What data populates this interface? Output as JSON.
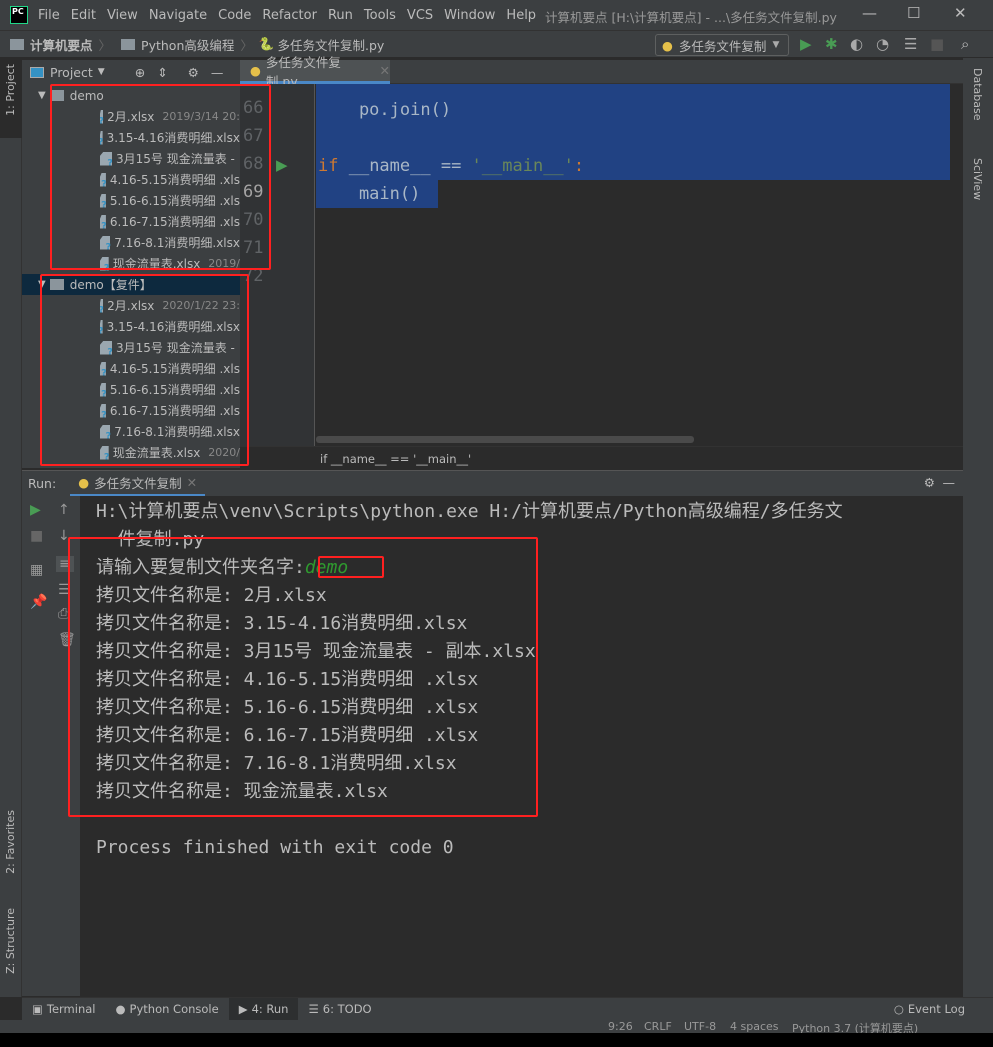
{
  "titlebar": {
    "logo": "PC",
    "menu": [
      "File",
      "Edit",
      "View",
      "Navigate",
      "Code",
      "Refactor",
      "Run",
      "Tools",
      "VCS",
      "Window",
      "Help"
    ],
    "title": "计算机要点 [H:\\计算机要点] - ...\\多任务文件复制.py"
  },
  "navbar": {
    "breadcrumbs": [
      "计算机要点",
      "Python高级编程",
      "多任务文件复制.py"
    ],
    "run_config": "多任务文件复制"
  },
  "left_stripe": {
    "project": "1: Project",
    "favorites": "2: Favorites",
    "structure": "Z: Structure"
  },
  "right_stripe": {
    "database": "Database",
    "sciview": "SciView"
  },
  "project": {
    "title": "Project",
    "folders": [
      {
        "name": "demo",
        "selected": false,
        "files": [
          {
            "name": "2月.xlsx",
            "date": "2019/3/14 20:"
          },
          {
            "name": "3.15-4.16消费明细.xlsx",
            "date": ""
          },
          {
            "name": "3月15号 现金流量表 - ",
            "date": ""
          },
          {
            "name": "4.16-5.15消费明细 .xls",
            "date": ""
          },
          {
            "name": "5.16-6.15消费明细 .xls",
            "date": ""
          },
          {
            "name": "6.16-7.15消费明细 .xls",
            "date": ""
          },
          {
            "name": "7.16-8.1消费明细.xlsx",
            "date": ""
          },
          {
            "name": "现金流量表.xlsx",
            "date": "2019/"
          }
        ]
      },
      {
        "name": "demo【复件】",
        "selected": true,
        "files": [
          {
            "name": "2月.xlsx",
            "date": "2020/1/22 23:"
          },
          {
            "name": "3.15-4.16消费明细.xlsx",
            "date": ""
          },
          {
            "name": "3月15号 现金流量表 - ",
            "date": ""
          },
          {
            "name": "4.16-5.15消费明细 .xls",
            "date": ""
          },
          {
            "name": "5.16-6.15消费明细 .xls",
            "date": ""
          },
          {
            "name": "6.16-7.15消费明细 .xls",
            "date": ""
          },
          {
            "name": "7.16-8.1消费明细.xlsx",
            "date": ""
          },
          {
            "name": "现金流量表.xlsx",
            "date": "2020/"
          }
        ]
      }
    ]
  },
  "editor": {
    "tab": "多任务文件复制.py",
    "line_numbers": [
      "66",
      "67",
      "68",
      "69",
      "70",
      "71",
      "72"
    ],
    "code": {
      "l66": "    po.join()",
      "l68_kw": "if",
      "l68_rest": " __name__ == ",
      "l68_str": "'__main__'",
      "l68_end": ":",
      "l69": "    main()"
    },
    "breadcrumb": "if __name__ == '__main__'"
  },
  "run": {
    "label": "Run:",
    "tab": "多任务文件复制",
    "console": {
      "cmd1": "H:\\计算机要点\\venv\\Scripts\\python.exe H:/计算机要点/Python高级编程/多任务文",
      "cmd2": "  件复制.py",
      "prompt": "请输入要复制文件夹名字:",
      "input": "demo",
      "lines": [
        "拷贝文件名称是: 2月.xlsx",
        "拷贝文件名称是: 3.15-4.16消费明细.xlsx",
        "拷贝文件名称是: 3月15号 现金流量表 - 副本.xlsx",
        "拷贝文件名称是: 4.16-5.15消费明细 .xlsx",
        "拷贝文件名称是: 5.16-6.15消费明细 .xlsx",
        "拷贝文件名称是: 6.16-7.15消费明细 .xlsx",
        "拷贝文件名称是: 7.16-8.1消费明细.xlsx",
        "拷贝文件名称是: 现金流量表.xlsx"
      ],
      "exit": "Process finished with exit code 0"
    }
  },
  "bottom_tabs": {
    "terminal": "Terminal",
    "python_console": "Python Console",
    "run": "4: Run",
    "todo": "6: TODO",
    "event_log": "Event Log"
  },
  "status": {
    "position": "9:26",
    "line_sep": "CRLF",
    "encoding": "UTF-8",
    "indent": "4 spaces",
    "interpreter": "Python 3.7 (计算机要点)"
  },
  "colors": {
    "accent": "#4a88c7",
    "selection": "#214283",
    "highlight_box": "#ff2020",
    "run_green": "#499c54"
  }
}
